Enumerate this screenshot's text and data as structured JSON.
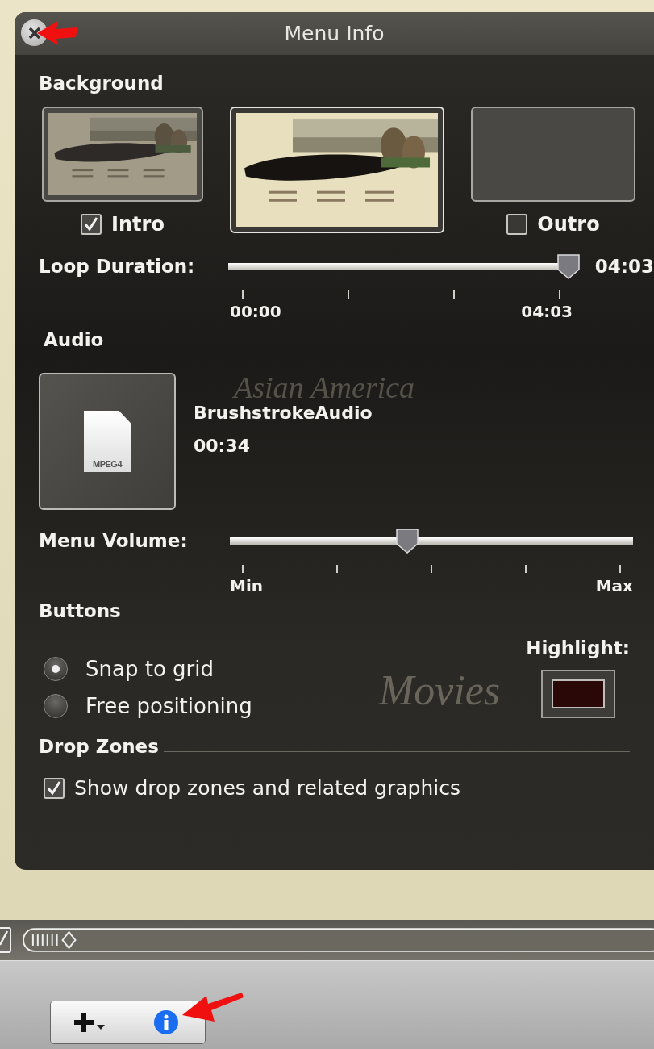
{
  "window": {
    "title": "Menu Info"
  },
  "background": {
    "heading": "Background",
    "thumbnails": [
      {
        "kind": "checkable",
        "label": "Intro",
        "checked": true,
        "selected": false,
        "empty": false
      },
      {
        "kind": "plain",
        "selected": true,
        "empty": false
      },
      {
        "kind": "checkable",
        "label": "Outro",
        "checked": false,
        "selected": false,
        "empty": true
      }
    ]
  },
  "loop_duration": {
    "label": "Loop Duration:",
    "level": 1.0,
    "reading": "04:03",
    "tick_labels": [
      "00:00",
      "04:03"
    ]
  },
  "audio": {
    "heading": "Audio",
    "file_icon_label": "MPEG4",
    "name": "BrushstrokeAudio",
    "duration": "00:34"
  },
  "menu_volume": {
    "label": "Menu Volume:",
    "level": 0.44,
    "tick_labels": [
      "Min",
      "Max"
    ]
  },
  "buttons_section": {
    "heading": "Buttons",
    "positioning": [
      {
        "label": "Snap to grid",
        "selected": true
      },
      {
        "label": "Free positioning",
        "selected": false
      }
    ],
    "highlight": {
      "label": "Highlight:",
      "color": "#2a0808"
    }
  },
  "drop_zones": {
    "heading": "Drop Zones",
    "show": {
      "label": "Show drop zones and related graphics",
      "checked": true
    }
  },
  "backdrop_texts": [
    "Asian America",
    "Movies"
  ],
  "timeline": {
    "checkbox_checked": true
  },
  "toolbar": {
    "buttons": [
      {
        "kind": "add"
      },
      {
        "kind": "info"
      }
    ]
  }
}
